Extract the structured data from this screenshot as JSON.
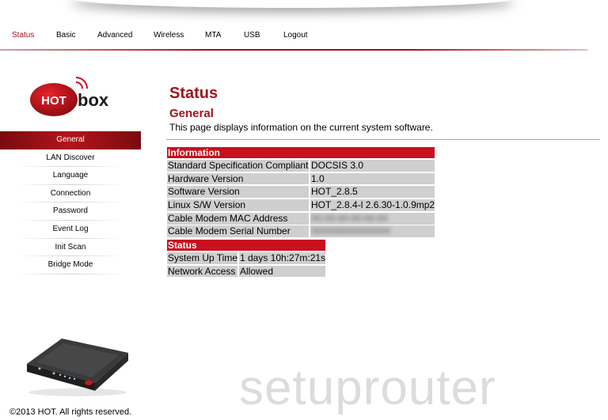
{
  "nav": {
    "items": [
      "Status",
      "Basic",
      "Advanced",
      "Wireless",
      "MTA",
      "USB",
      "Logout"
    ],
    "active": "Status"
  },
  "logo": {
    "hot": "HOT",
    "box": "box"
  },
  "sidebar": {
    "items": [
      "General",
      "LAN Discover",
      "Language",
      "Connection",
      "Password",
      "Event Log",
      "Init Scan",
      "Bridge Mode"
    ],
    "active": "General"
  },
  "page": {
    "title": "Status",
    "subtitle": "General",
    "description": "This page displays information on the current system software."
  },
  "information": {
    "header": "Information",
    "rows": [
      {
        "label": "Standard Specification Compliant",
        "value": "DOCSIS 3.0"
      },
      {
        "label": "Hardware Version",
        "value": "1.0"
      },
      {
        "label": "Software Version",
        "value": "HOT_2.8.5"
      },
      {
        "label": "Linux S/W Version",
        "value": "HOT_2.8.4-l 2.6.30-1.0.9mp2"
      },
      {
        "label": "Cable Modem MAC Address",
        "value": "00:00:00:00:00:00"
      },
      {
        "label": "Cable Modem Serial Number",
        "value": "000000000000000"
      }
    ]
  },
  "status": {
    "header": "Status",
    "rows": [
      {
        "label": "System Up Time",
        "value": "1 days 10h:27m:21s"
      },
      {
        "label": "Network Access",
        "value": "Allowed"
      }
    ]
  },
  "footer": {
    "copyright": "©2013 HOT. All rights reserved."
  },
  "watermark": "setuprouter",
  "colors": {
    "brand_red": "#a0141c",
    "table_header": "#c8101e",
    "cell_bg": "#cfcfcf"
  }
}
